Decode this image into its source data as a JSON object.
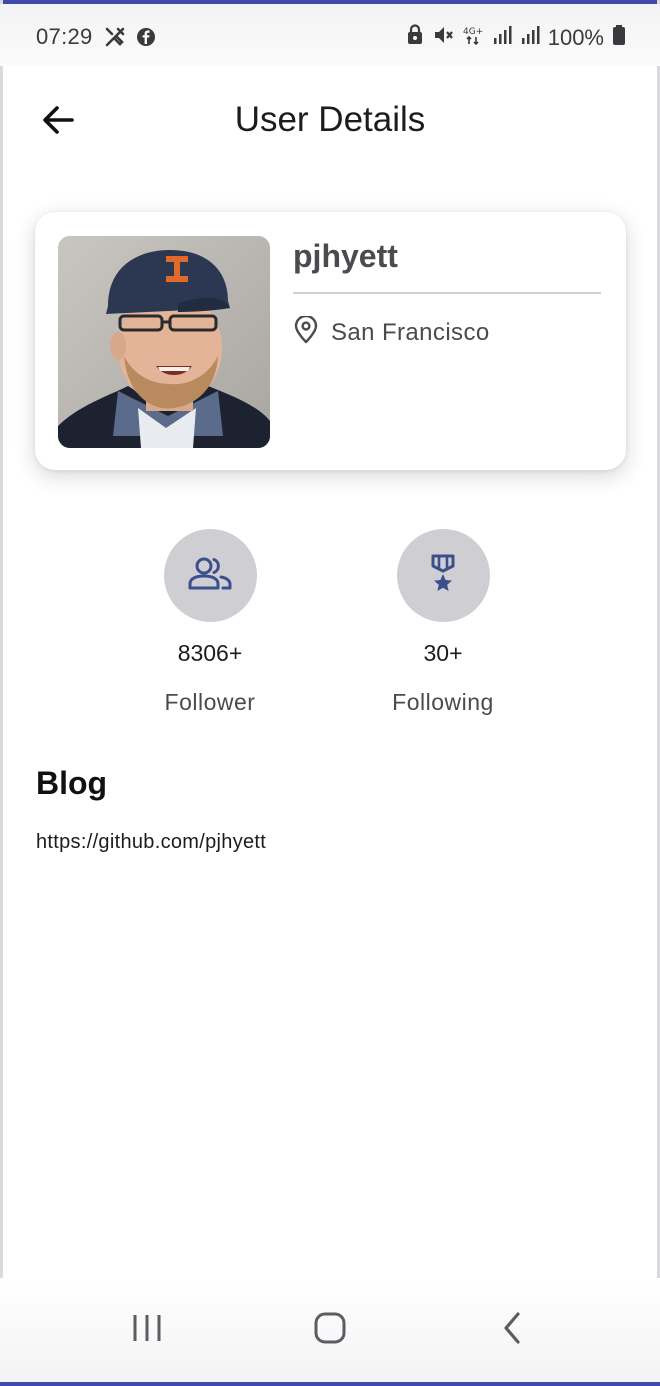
{
  "status_bar": {
    "time": "07:29",
    "battery_text": "100%",
    "left_icons": [
      "tools-icon",
      "facebook-icon"
    ],
    "right_icons": [
      "lock-icon",
      "mute-icon",
      "data-4g-icon",
      "signal-icon",
      "signal-icon",
      "battery-icon"
    ]
  },
  "app_bar": {
    "title": "User Details",
    "back_icon": "arrow-left-icon"
  },
  "profile": {
    "username": "pjhyett",
    "location": "San Francisco",
    "location_icon": "map-pin-icon",
    "avatar_icon": "user-photo"
  },
  "stats": [
    {
      "value": "8306+",
      "label": "Follower",
      "icon": "people-icon"
    },
    {
      "value": "30+",
      "label": "Following",
      "icon": "medal-icon"
    }
  ],
  "blog": {
    "heading": "Blog",
    "url": "https://github.com/pjhyett"
  },
  "nav_bar": {
    "items": [
      "recents-icon",
      "home-icon",
      "back-icon"
    ]
  },
  "colors": {
    "accent": "#3f4aa6",
    "icon_blue": "#3b4f8c",
    "circle_bg": "#cfcfd3",
    "frame": "#3f4aa6"
  }
}
